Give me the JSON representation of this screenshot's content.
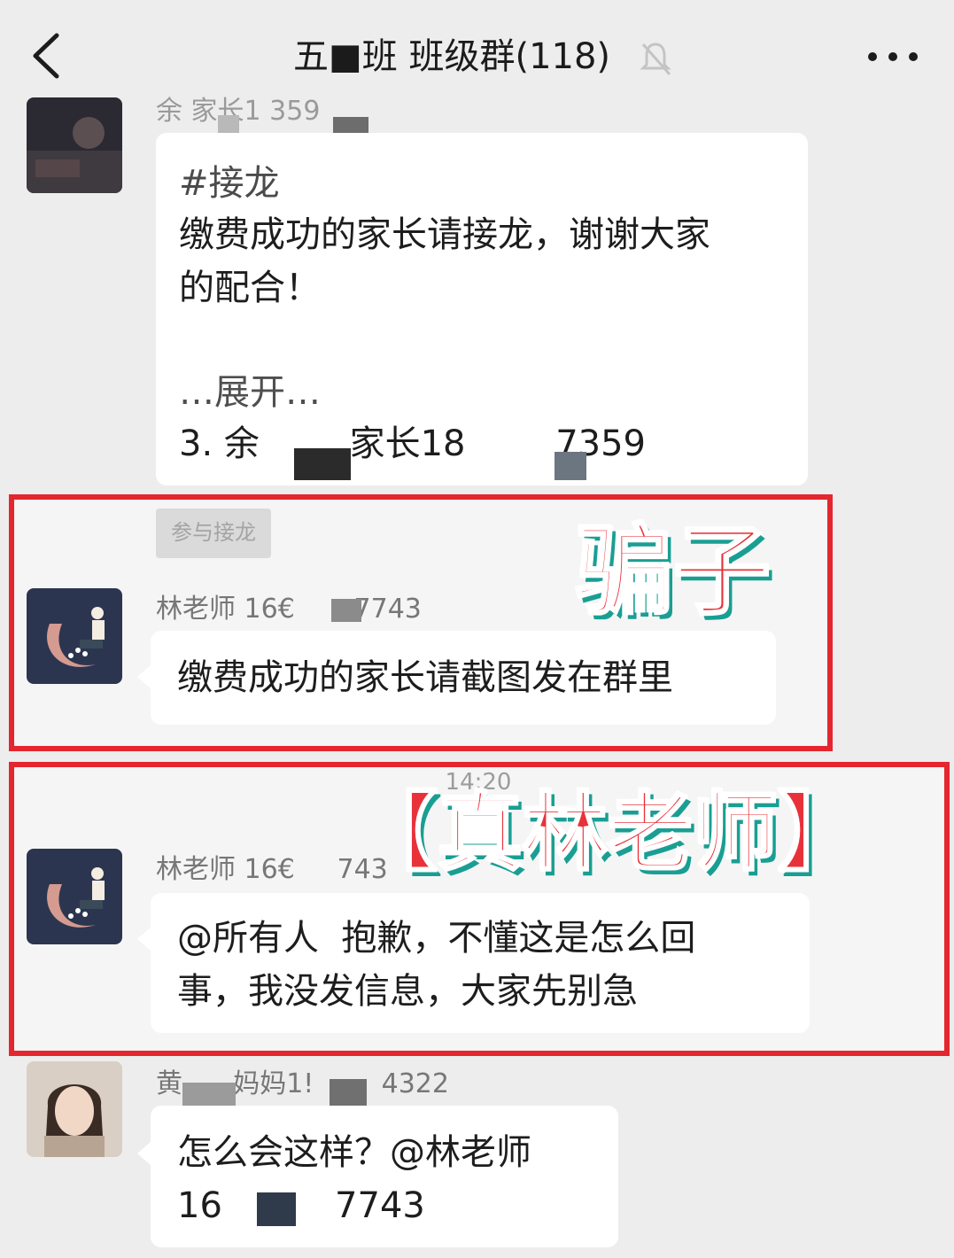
{
  "header": {
    "back_icon": "chevron-left-icon",
    "title": "五■班 班级群(118)",
    "mute_icon": "bell-muted-icon",
    "more_icon": "more-dots-icon"
  },
  "messages": [
    {
      "sender": "余    家长1     359",
      "lines": [
        "#接龙",
        "缴费成功的家长请接龙，谢谢大家",
        "的配合！",
        "",
        "…展开…",
        "3. 余        家长18        7359"
      ]
    },
    {
      "tag": "参与接龙",
      "sender": "林老师 16€       7743",
      "text": "缴费成功的家长请截图发在群里",
      "stamp": "骗子"
    },
    {
      "time": "14:20",
      "sender": "林老师 16€     743",
      "lines": [
        "@所有人  抱歉，不懂这是怎么回",
        "事，我没发信息，大家先别急"
      ],
      "stamp": "【真林老师】"
    },
    {
      "sender": "黄      妈妈1!        4322",
      "lines": [
        "怎么会这样？@林老师",
        "16          7743"
      ]
    }
  ],
  "colors": {
    "background": "#ededed",
    "highlight_border": "#e4262e",
    "stamp_red": "#e8323a",
    "stamp_shadow": "#1a9e93"
  }
}
